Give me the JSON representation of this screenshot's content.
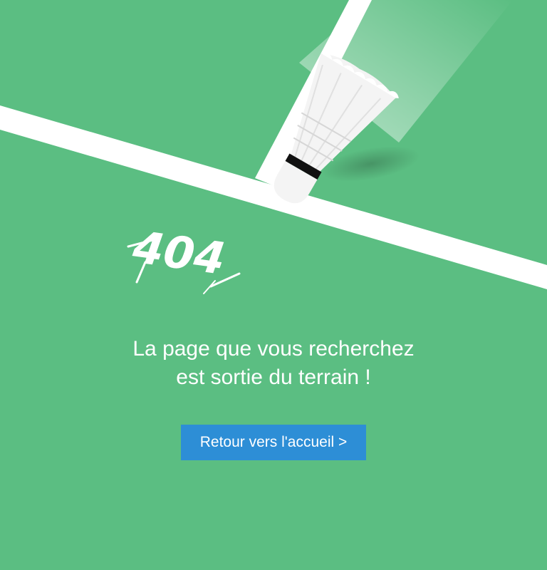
{
  "error": {
    "code": "404"
  },
  "message": {
    "line1": "La page que vous recherchez",
    "line2": "est sortie du terrain !"
  },
  "home_button": {
    "label": "Retour vers l'accueil >"
  },
  "colors": {
    "background": "#5bbe82",
    "court_line": "#ffffff",
    "button": "#2d8ed6",
    "shuttlecock_band": "#111111"
  },
  "illustration": {
    "icon": "shuttlecock-icon"
  }
}
